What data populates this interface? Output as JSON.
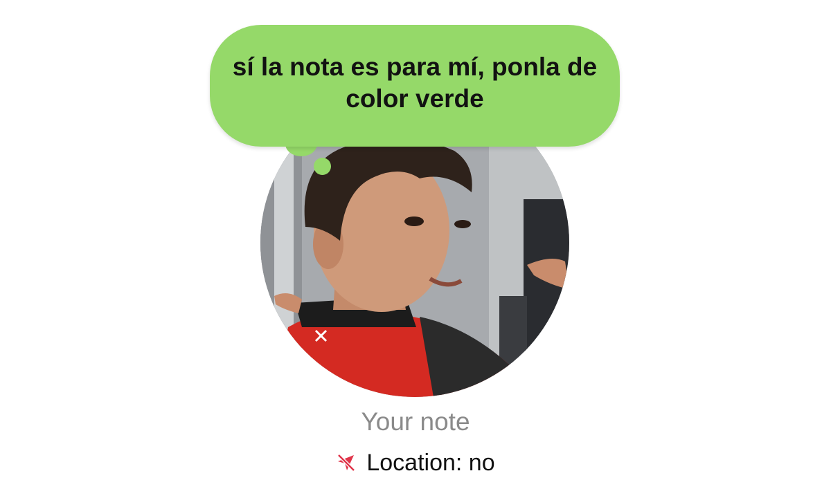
{
  "note": {
    "text": "sí la nota es para mí, ponla de color verde",
    "bubble_color": "#95d969"
  },
  "profile": {
    "avatar_alt": "profile photo",
    "your_note_label": "Your note"
  },
  "location": {
    "icon": "location-off-icon",
    "label": "Location: no",
    "icon_color": "#e0354a"
  }
}
